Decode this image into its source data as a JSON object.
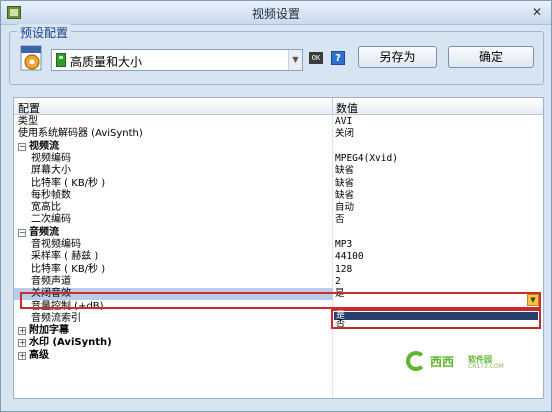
{
  "window": {
    "title": "视频设置",
    "close_glyph": "✕"
  },
  "preset": {
    "legend": "预设配置",
    "selected": "高质量和大小",
    "ok_icon_text": "OK",
    "help_glyph": "?",
    "save_as_label": "另存为",
    "confirm_label": "确定"
  },
  "grid": {
    "header": {
      "config": "配置",
      "value": "数值"
    },
    "rows": [
      {
        "type": "prop",
        "name": "类型",
        "value": "AVI"
      },
      {
        "type": "prop",
        "name": "使用系统解码器 (AviSynth)",
        "value": "关闭"
      },
      {
        "type": "group",
        "expander": "−",
        "name": "视频流"
      },
      {
        "type": "child",
        "name": "视频编码",
        "value": "MPEG4(Xvid)"
      },
      {
        "type": "child",
        "name": "屏幕大小",
        "value": "缺省"
      },
      {
        "type": "child",
        "name": "比特率 ( KB/秒 )",
        "value": "缺省"
      },
      {
        "type": "child",
        "name": "每秒帧数",
        "value": "缺省"
      },
      {
        "type": "child",
        "name": "宽高比",
        "value": "自动"
      },
      {
        "type": "child",
        "name": "二次编码",
        "value": "否"
      },
      {
        "type": "group",
        "expander": "−",
        "name": "音频流"
      },
      {
        "type": "child",
        "name": "音视频编码",
        "value": "MP3"
      },
      {
        "type": "child",
        "name": "采样率 ( 赫兹 )",
        "value": "44100"
      },
      {
        "type": "child",
        "name": "比特率 ( KB/秒 )",
        "value": "128"
      },
      {
        "type": "child",
        "name": "音频声道",
        "value": "2"
      },
      {
        "type": "child",
        "name": "关闭音效",
        "value": "是",
        "selected": true
      },
      {
        "type": "child",
        "name": "音量控制 (+dB)",
        "value": ""
      },
      {
        "type": "child",
        "name": "音频流索引",
        "value": ""
      },
      {
        "type": "group",
        "expander": "+",
        "name": "附加字幕"
      },
      {
        "type": "group",
        "expander": "+",
        "name": "水印 (AviSynth)"
      },
      {
        "type": "group",
        "expander": "+",
        "name": "高级"
      }
    ],
    "dropdown": {
      "options": [
        "是",
        "否"
      ],
      "highlighted": "是"
    }
  },
  "watermark": {
    "brand": "西西",
    "sub": "软件园",
    "url": "CR173.COM"
  },
  "colors": {
    "accent": "#cc2b2b",
    "selection": "#b9cdea",
    "dropdown_highlight": "#26406b",
    "watermark": "#5fb62a"
  }
}
